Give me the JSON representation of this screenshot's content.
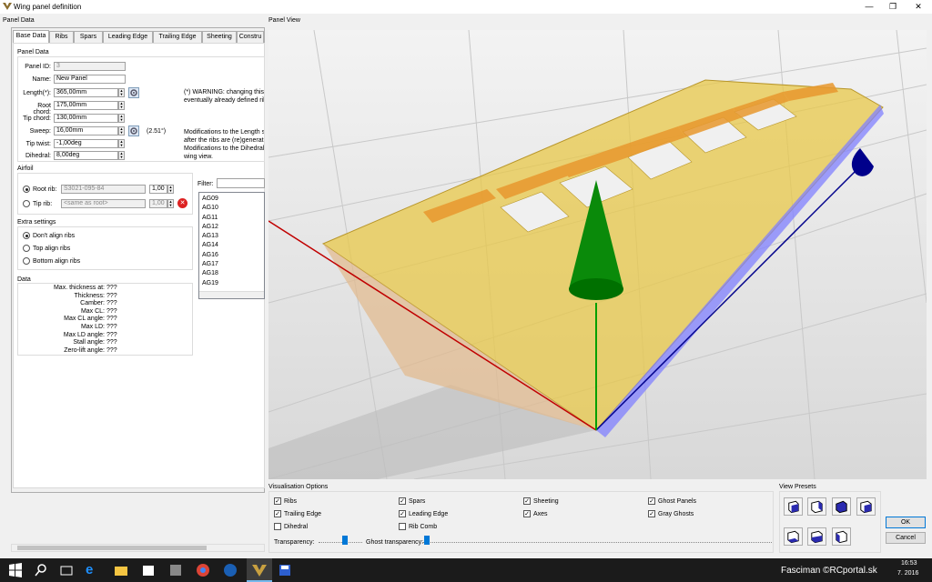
{
  "window": {
    "title": "Wing panel definition",
    "minimize": "—",
    "maximize": "❐",
    "close": "✕"
  },
  "left_group_title": "Panel Data",
  "tabs": [
    "Base Data",
    "Ribs",
    "Spars",
    "Leading Edge",
    "Trailing Edge",
    "Sheeting",
    "Constru"
  ],
  "panel_data": {
    "title": "Panel Data",
    "panel_id_label": "Panel ID:",
    "panel_id": "3",
    "name_label": "Name:",
    "name": "New Panel",
    "length_label": "Length(*):",
    "length": "365,00mm",
    "root_chord_label": "Root chord:",
    "root_chord": "175,00mm",
    "tip_chord_label": "Tip chord:",
    "tip_chord": "130,00mm",
    "sweep_label": "Sweep:",
    "sweep": "16,00mm",
    "sweep_angle": "(2.51°)",
    "tip_twist_label": "Tip twist:",
    "tip_twist": "-1,00deg",
    "dihedral_label": "Dihedral:",
    "dihedral": "8,00deg",
    "warning_line1": "(*) WARNING: changing this v",
    "warning_line2": "eventually already defined ribs",
    "mod_line1": "Modifications to the Length se",
    "mod_line2": "after the ribs are (re)generat",
    "mod_line3": "Modifications to the Dihedral's",
    "mod_line4": "wing view."
  },
  "airfoil": {
    "title": "Airfoil",
    "root_label": "Root rib:",
    "root_value": "S3021-095-84",
    "root_scale": "1,00",
    "tip_label": "Tip rib:",
    "tip_value": "<same as root>",
    "tip_scale": "1,00",
    "filter_label": "Filter:",
    "list": [
      "AG09",
      "AG10",
      "AG11",
      "AG12",
      "AG13",
      "AG14",
      "AG16",
      "AG17",
      "AG18",
      "AG19"
    ]
  },
  "extra": {
    "title": "Extra settings",
    "options": [
      "Don't align ribs",
      "Top align ribs",
      "Bottom align ribs"
    ]
  },
  "data_section": {
    "title": "Data",
    "rows": [
      {
        "label": "Max. thickness at:",
        "value": "???"
      },
      {
        "label": "Thickness:",
        "value": "???"
      },
      {
        "label": "Camber:",
        "value": "???"
      },
      {
        "label": "Max CL:",
        "value": "???"
      },
      {
        "label": "Max CL angle:",
        "value": "???"
      },
      {
        "label": "Max LD:",
        "value": "???"
      },
      {
        "label": "Max LD angle:",
        "value": "???"
      },
      {
        "label": "Stall angle:",
        "value": "???"
      },
      {
        "label": "Zero-lift angle:",
        "value": "???"
      }
    ]
  },
  "view": {
    "title": "Panel View"
  },
  "vis": {
    "title": "Visualisation Options",
    "checks": [
      {
        "label": "Ribs",
        "checked": true
      },
      {
        "label": "Spars",
        "checked": true
      },
      {
        "label": "Sheeting",
        "checked": true
      },
      {
        "label": "Ghost Panels",
        "checked": true
      },
      {
        "label": "Trailing Edge",
        "checked": true
      },
      {
        "label": "Leading Edge",
        "checked": true
      },
      {
        "label": "Axes",
        "checked": true
      },
      {
        "label": "Gray Ghosts",
        "checked": true
      },
      {
        "label": "Dihedral",
        "checked": false
      },
      {
        "label": "Rib Comb",
        "checked": false
      }
    ],
    "transparency_label": "Transparency:",
    "ghost_label": "Ghost transparency:"
  },
  "presets": {
    "title": "View Presets"
  },
  "buttons": {
    "ok": "OK",
    "cancel": "Cancel"
  },
  "taskbar": {
    "user_text": "Fasciman ©RCportal.sk",
    "time": "16:53",
    "date": "7. 2016"
  },
  "colors": {
    "accent": "#0078d7",
    "wing": "#e8c84a",
    "rib": "#e8982e",
    "axis_x": "#c00000",
    "axis_y": "#00a000",
    "axis_z": "#00008b",
    "edge": "#8080ff"
  }
}
